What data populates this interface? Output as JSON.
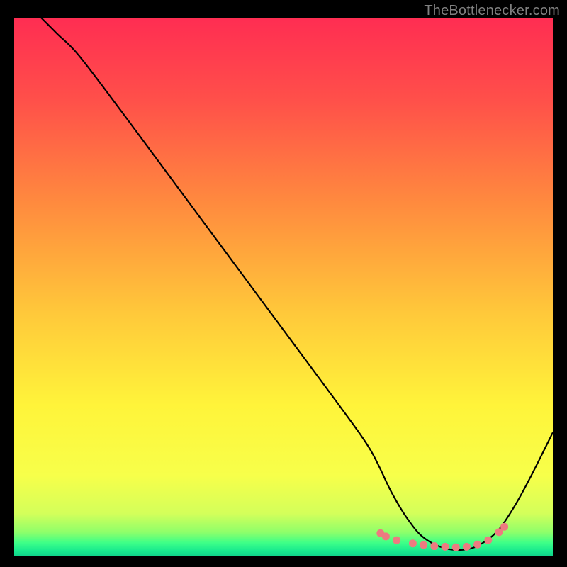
{
  "attribution": "TheBottlenecker.com",
  "chart_data": {
    "type": "line",
    "title": "",
    "xlabel": "",
    "ylabel": "",
    "xlim": [
      0,
      100
    ],
    "ylim": [
      0,
      100
    ],
    "series": [
      {
        "name": "curve",
        "style": "line",
        "color": "#000000",
        "x": [
          5,
          8,
          12,
          20,
          30,
          40,
          50,
          60,
          66,
          70,
          73,
          76,
          80,
          84,
          87,
          90,
          93,
          96,
          100
        ],
        "y": [
          100,
          97,
          93,
          82.5,
          69,
          55.5,
          42,
          28.5,
          20,
          12,
          7,
          3.5,
          1.5,
          1.3,
          2.5,
          5,
          9.5,
          15,
          23
        ]
      },
      {
        "name": "highlight-dots",
        "style": "dots",
        "color": "#ed7b80",
        "x": [
          68,
          69,
          71,
          74,
          76,
          78,
          80,
          82,
          84,
          86,
          88,
          90,
          91
        ],
        "y": [
          4.3,
          3.7,
          3.0,
          2.4,
          2.1,
          1.9,
          1.8,
          1.7,
          1.8,
          2.2,
          3.0,
          4.5,
          5.5
        ]
      }
    ],
    "background_gradient": {
      "stops": [
        {
          "offset": 0.0,
          "color": "#ff2d52"
        },
        {
          "offset": 0.15,
          "color": "#ff4f4a"
        },
        {
          "offset": 0.35,
          "color": "#ff8c3e"
        },
        {
          "offset": 0.55,
          "color": "#ffc93a"
        },
        {
          "offset": 0.72,
          "color": "#fff43a"
        },
        {
          "offset": 0.85,
          "color": "#f7ff4a"
        },
        {
          "offset": 0.92,
          "color": "#d4ff5a"
        },
        {
          "offset": 0.955,
          "color": "#8fff6a"
        },
        {
          "offset": 0.975,
          "color": "#3dff88"
        },
        {
          "offset": 0.99,
          "color": "#17e98e"
        },
        {
          "offset": 1.0,
          "color": "#0fd18a"
        }
      ]
    }
  }
}
